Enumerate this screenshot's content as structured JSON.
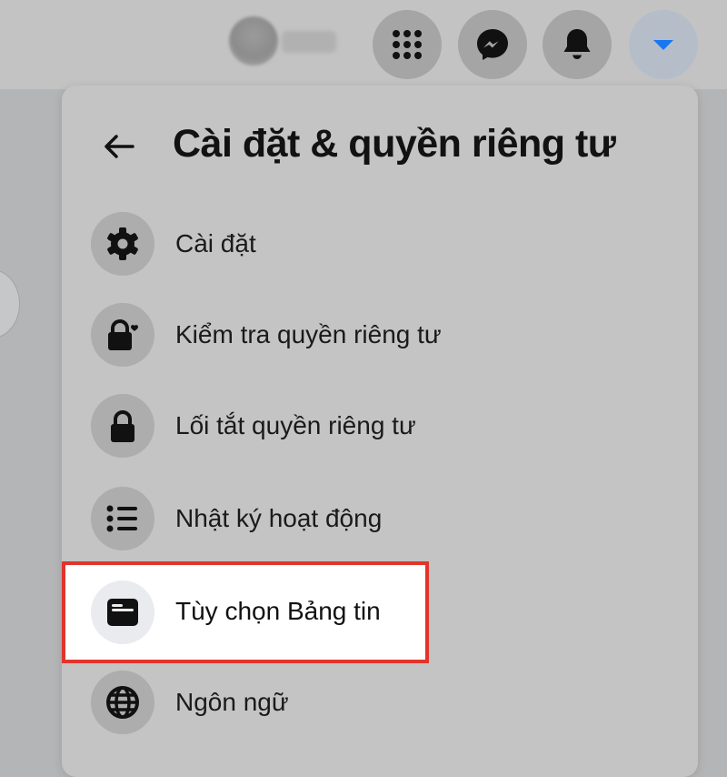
{
  "header": {
    "apps_icon": "grid-icon",
    "messenger_icon": "messenger-icon",
    "notifications_icon": "bell-icon",
    "account_icon": "caret-down-icon",
    "accent_color": "#1877f2"
  },
  "menu": {
    "title": "Cài đặt & quyền riêng tư",
    "back_icon": "arrow-left-icon",
    "items": [
      {
        "label": "Cài đặt",
        "icon": "gear-icon"
      },
      {
        "label": "Kiểm tra quyền riêng tư",
        "icon": "lock-heart-icon"
      },
      {
        "label": "Lối tắt quyền riêng tư",
        "icon": "lock-icon"
      },
      {
        "label": "Nhật ký hoạt động",
        "icon": "list-icon"
      },
      {
        "label": "Tùy chọn Bảng tin",
        "icon": "news-feed-icon",
        "highlighted": true
      },
      {
        "label": "Ngôn ngữ",
        "icon": "globe-icon"
      }
    ]
  },
  "highlight_color": "#e1352b"
}
